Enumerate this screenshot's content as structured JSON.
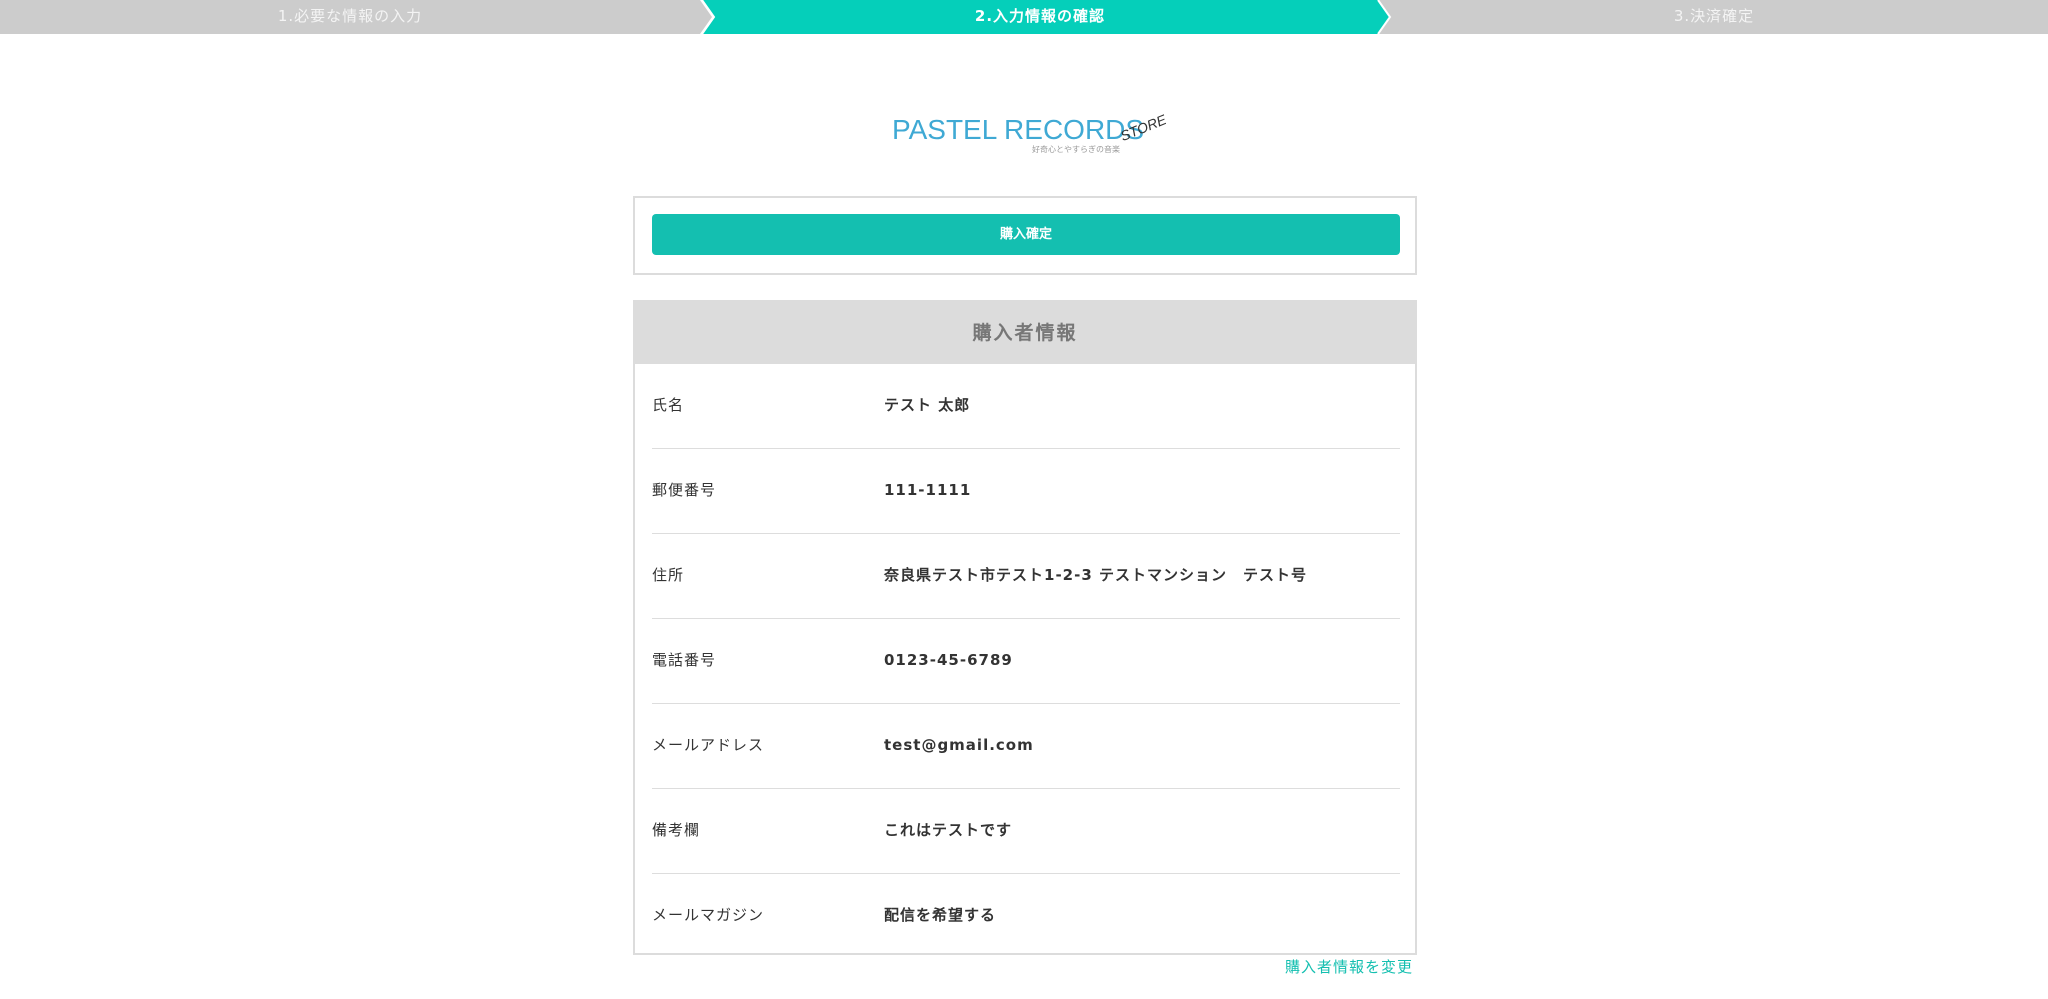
{
  "steps": {
    "items": [
      {
        "label": "1.必要な情報の入力",
        "state": "done"
      },
      {
        "label": "2.入力情報の確認",
        "state": "active"
      },
      {
        "label": "3.決済確定",
        "state": "pending"
      }
    ]
  },
  "logo": {
    "main": "PASTEL RECORDS",
    "sub": "好奇心とやすらぎの音楽",
    "store": "STORE"
  },
  "confirm": {
    "button_label": "購入確定"
  },
  "purchaser": {
    "title": "購入者情報",
    "rows": [
      {
        "label": "氏名",
        "value": "テスト 太郎"
      },
      {
        "label": "郵便番号",
        "value": "111-1111"
      },
      {
        "label": "住所",
        "value": "奈良県テスト市テスト1-2-3 テストマンション　テスト号"
      },
      {
        "label": "電話番号",
        "value": "0123-45-6789"
      },
      {
        "label": "メールアドレス",
        "value": "test@gmail.com"
      },
      {
        "label": "備考欄",
        "value": "これはテストです"
      },
      {
        "label": "メールマガジン",
        "value": "配信を希望する"
      }
    ],
    "edit_link": "購入者情報を変更"
  },
  "colors": {
    "accent": "#14bfb0",
    "step_active": "#05cfba",
    "step_inactive": "#cccccc",
    "logo_blue": "#3fa9d4",
    "header_bg": "#dcdcdc"
  }
}
